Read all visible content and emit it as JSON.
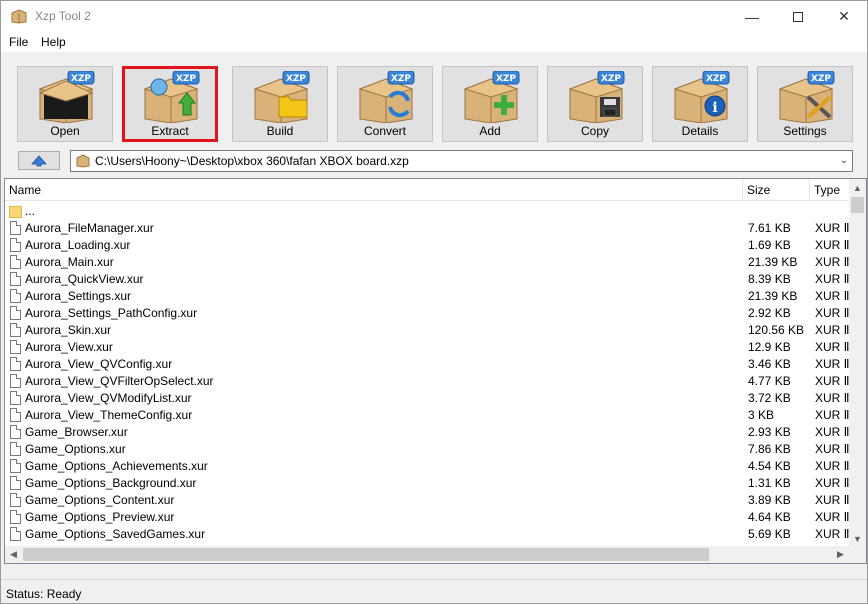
{
  "window": {
    "title": "Xzp Tool 2"
  },
  "menu": {
    "file": "File",
    "help": "Help"
  },
  "toolbar": {
    "badge": "XZP",
    "buttons": [
      {
        "label": "Open",
        "icon": "box-open-icon"
      },
      {
        "label": "Extract",
        "icon": "box-extract-icon",
        "selected": true
      },
      {
        "label": "Build",
        "icon": "box-folder-icon"
      },
      {
        "label": "Convert",
        "icon": "box-convert-icon"
      },
      {
        "label": "Add",
        "icon": "box-add-icon"
      },
      {
        "label": "Copy",
        "icon": "box-floppy-icon"
      },
      {
        "label": "Details",
        "icon": "box-info-icon"
      },
      {
        "label": "Settings",
        "icon": "box-tools-icon"
      }
    ]
  },
  "path": {
    "value": "C:\\Users\\Hoony~\\Desktop\\xbox 360\\fafan XBOX board.xzp"
  },
  "list": {
    "columns": {
      "name": "Name",
      "size": "Size",
      "type": "Type"
    },
    "parent": "...",
    "rows": [
      {
        "name": "Aurora_FileManager.xur",
        "size": "7.61 KB",
        "type": "XUR Ⅱ"
      },
      {
        "name": "Aurora_Loading.xur",
        "size": "1.69 KB",
        "type": "XUR Ⅱ"
      },
      {
        "name": "Aurora_Main.xur",
        "size": "21.39 KB",
        "type": "XUR Ⅱ"
      },
      {
        "name": "Aurora_QuickView.xur",
        "size": "8.39 KB",
        "type": "XUR Ⅱ"
      },
      {
        "name": "Aurora_Settings.xur",
        "size": "21.39 KB",
        "type": "XUR Ⅱ"
      },
      {
        "name": "Aurora_Settings_PathConfig.xur",
        "size": "2.92 KB",
        "type": "XUR Ⅱ"
      },
      {
        "name": "Aurora_Skin.xur",
        "size": "120.56 KB",
        "type": "XUR Ⅱ"
      },
      {
        "name": "Aurora_View.xur",
        "size": "12.9 KB",
        "type": "XUR Ⅱ"
      },
      {
        "name": "Aurora_View_QVConfig.xur",
        "size": "3.46 KB",
        "type": "XUR Ⅱ"
      },
      {
        "name": "Aurora_View_QVFilterOpSelect.xur",
        "size": "4.77 KB",
        "type": "XUR Ⅱ"
      },
      {
        "name": "Aurora_View_QVModifyList.xur",
        "size": "3.72 KB",
        "type": "XUR Ⅱ"
      },
      {
        "name": "Aurora_View_ThemeConfig.xur",
        "size": "3 KB",
        "type": "XUR Ⅱ"
      },
      {
        "name": "Game_Browser.xur",
        "size": "2.93 KB",
        "type": "XUR Ⅱ"
      },
      {
        "name": "Game_Options.xur",
        "size": "7.86 KB",
        "type": "XUR Ⅱ"
      },
      {
        "name": "Game_Options_Achievements.xur",
        "size": "4.54 KB",
        "type": "XUR Ⅱ"
      },
      {
        "name": "Game_Options_Background.xur",
        "size": "1.31 KB",
        "type": "XUR Ⅱ"
      },
      {
        "name": "Game_Options_Content.xur",
        "size": "3.89 KB",
        "type": "XUR Ⅱ"
      },
      {
        "name": "Game_Options_Preview.xur",
        "size": "4.64 KB",
        "type": "XUR Ⅱ"
      },
      {
        "name": "Game_Options_SavedGames.xur",
        "size": "5.69 KB",
        "type": "XUR Ⅱ"
      }
    ]
  },
  "status": {
    "text": "Status: Ready"
  }
}
